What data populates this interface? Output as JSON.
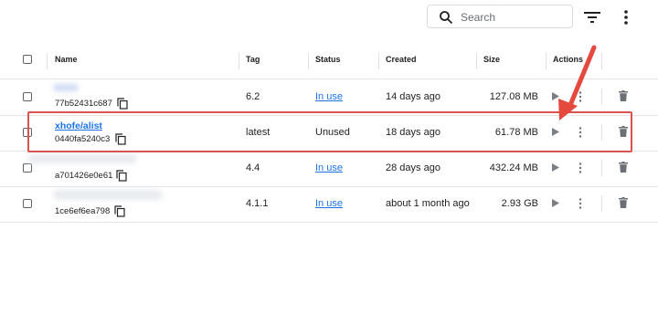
{
  "toolbar": {
    "search_placeholder": "Search",
    "search_icon": "search-icon",
    "filter_icon": "filter-icon",
    "more_icon": "more-vert-icon"
  },
  "table": {
    "headers": {
      "name": "Name",
      "tag": "Tag",
      "status": "Status",
      "created": "Created",
      "size": "Size",
      "actions": "Actions"
    },
    "rows": [
      {
        "name": "",
        "id": "77b52431c687",
        "tag": "6.2",
        "status": "In use",
        "created": "14 days ago",
        "size": "127.08 MB"
      },
      {
        "name": "xhofe/alist",
        "id": "0440fa5240c3",
        "tag": "latest",
        "status": "Unused",
        "created": "18 days ago",
        "size": "61.78 MB"
      },
      {
        "name": "",
        "id": "a701426e0e61",
        "tag": "4.4",
        "status": "In use",
        "created": "28 days ago",
        "size": "432.24 MB"
      },
      {
        "name": "",
        "id": "1ce6ef6ea798",
        "tag": "4.1.1",
        "status": "In use",
        "created": "about 1 month ago",
        "size": "2.93 GB"
      }
    ]
  },
  "colors": {
    "link": "#1a73e8",
    "highlight_box": "#d9534f",
    "arrow": "#e5483d",
    "icon_gray": "#6b6f76"
  }
}
